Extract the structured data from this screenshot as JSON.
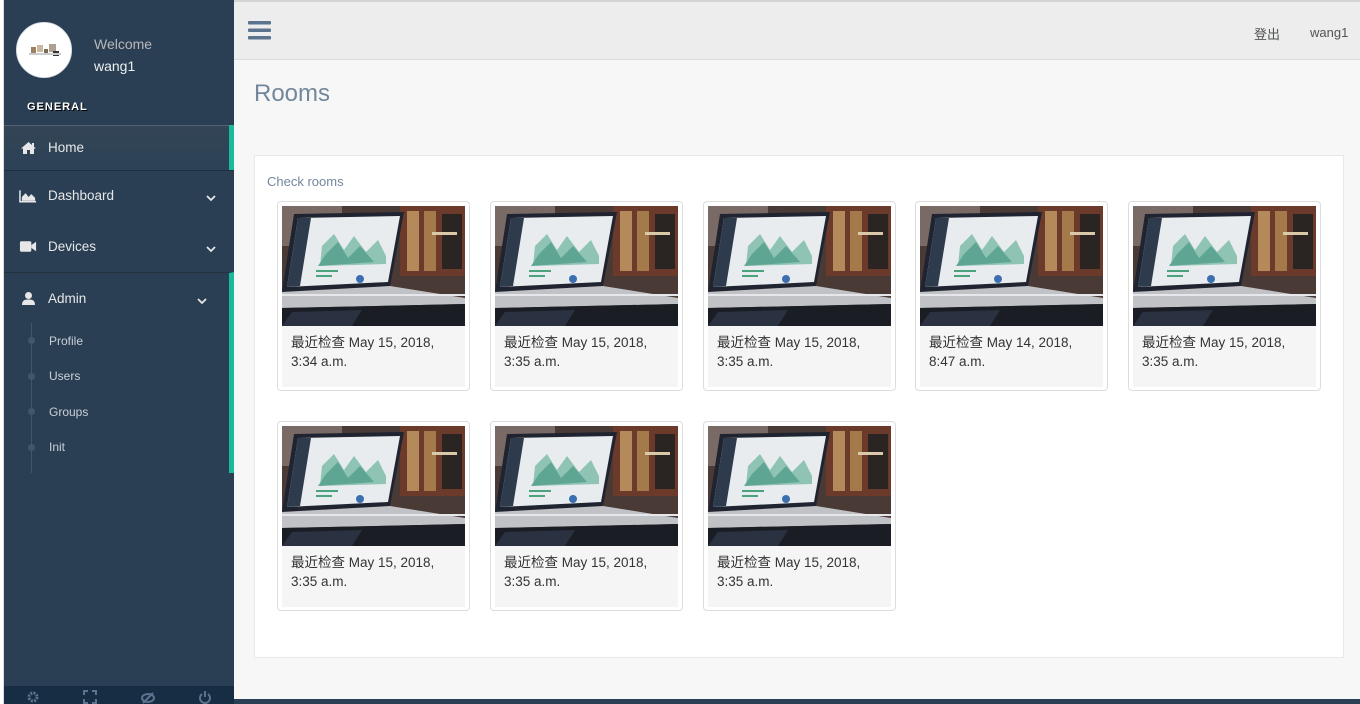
{
  "sidebar": {
    "welcome": "Welcome",
    "username": "wang1",
    "section_title": "GENERAL",
    "menu": {
      "home": "Home",
      "dashboard": "Dashboard",
      "devices": "Devices",
      "admin": "Admin"
    },
    "admin_submenu": [
      "Profile",
      "Users",
      "Groups",
      "Init"
    ],
    "footer_icons": [
      "gear-icon",
      "fullscreen-icon",
      "eye-slash-icon",
      "power-icon"
    ]
  },
  "topnav": {
    "logout": "登出",
    "user": "wang1"
  },
  "page": {
    "title": "Rooms",
    "panel_title": "Check rooms"
  },
  "rooms": [
    {
      "line1": "最近检查 May 15, 2018,",
      "line2": "3:34 a.m."
    },
    {
      "line1": "最近检查 May 15, 2018,",
      "line2": "3:35 a.m."
    },
    {
      "line1": "最近检查 May 15, 2018,",
      "line2": "3:35 a.m."
    },
    {
      "line1": "最近检查 May 14, 2018,",
      "line2": "8:47 a.m."
    },
    {
      "line1": "最近检查 May 15, 2018,",
      "line2": "3:35 a.m."
    },
    {
      "line1": "最近检查 May 15, 2018,",
      "line2": "3:35 a.m."
    },
    {
      "line1": "最近检查 May 15, 2018,",
      "line2": "3:35 a.m."
    },
    {
      "line1": "最近检查 May 15, 2018,",
      "line2": "3:35 a.m."
    }
  ],
  "colors": {
    "sidebar_bg": "#2A3F54",
    "accent": "#1ABB9C",
    "title": "#73879C"
  }
}
